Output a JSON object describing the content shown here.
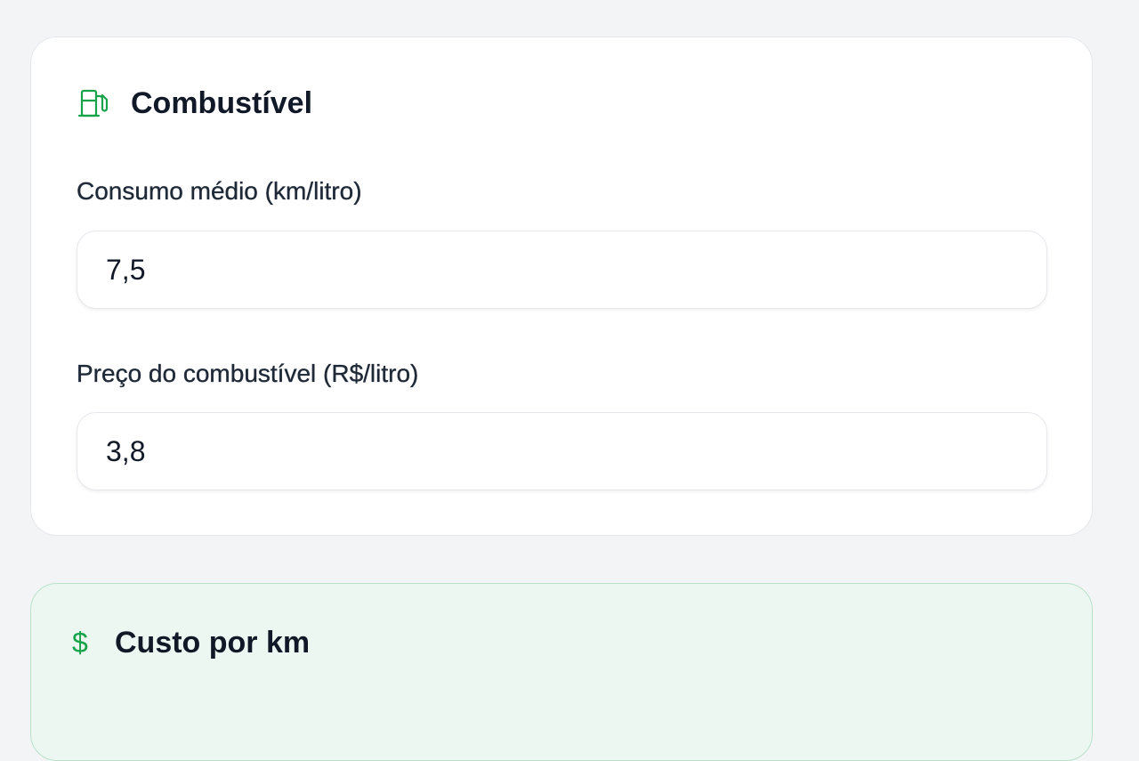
{
  "fuel_card": {
    "icon": "fuel-pump-icon",
    "title": "Combustível",
    "consumption": {
      "label": "Consumo médio (km/litro)",
      "value": "7,5"
    },
    "price": {
      "label": "Preço do combustível (R$/litro)",
      "value": "3,8"
    }
  },
  "cost_card": {
    "icon": "dollar-icon",
    "icon_glyph": "$",
    "title": "Custo por km"
  },
  "colors": {
    "accent": "#16a34a",
    "page_bg": "#f3f4f6",
    "cost_card_bg": "#ecf7f1"
  }
}
